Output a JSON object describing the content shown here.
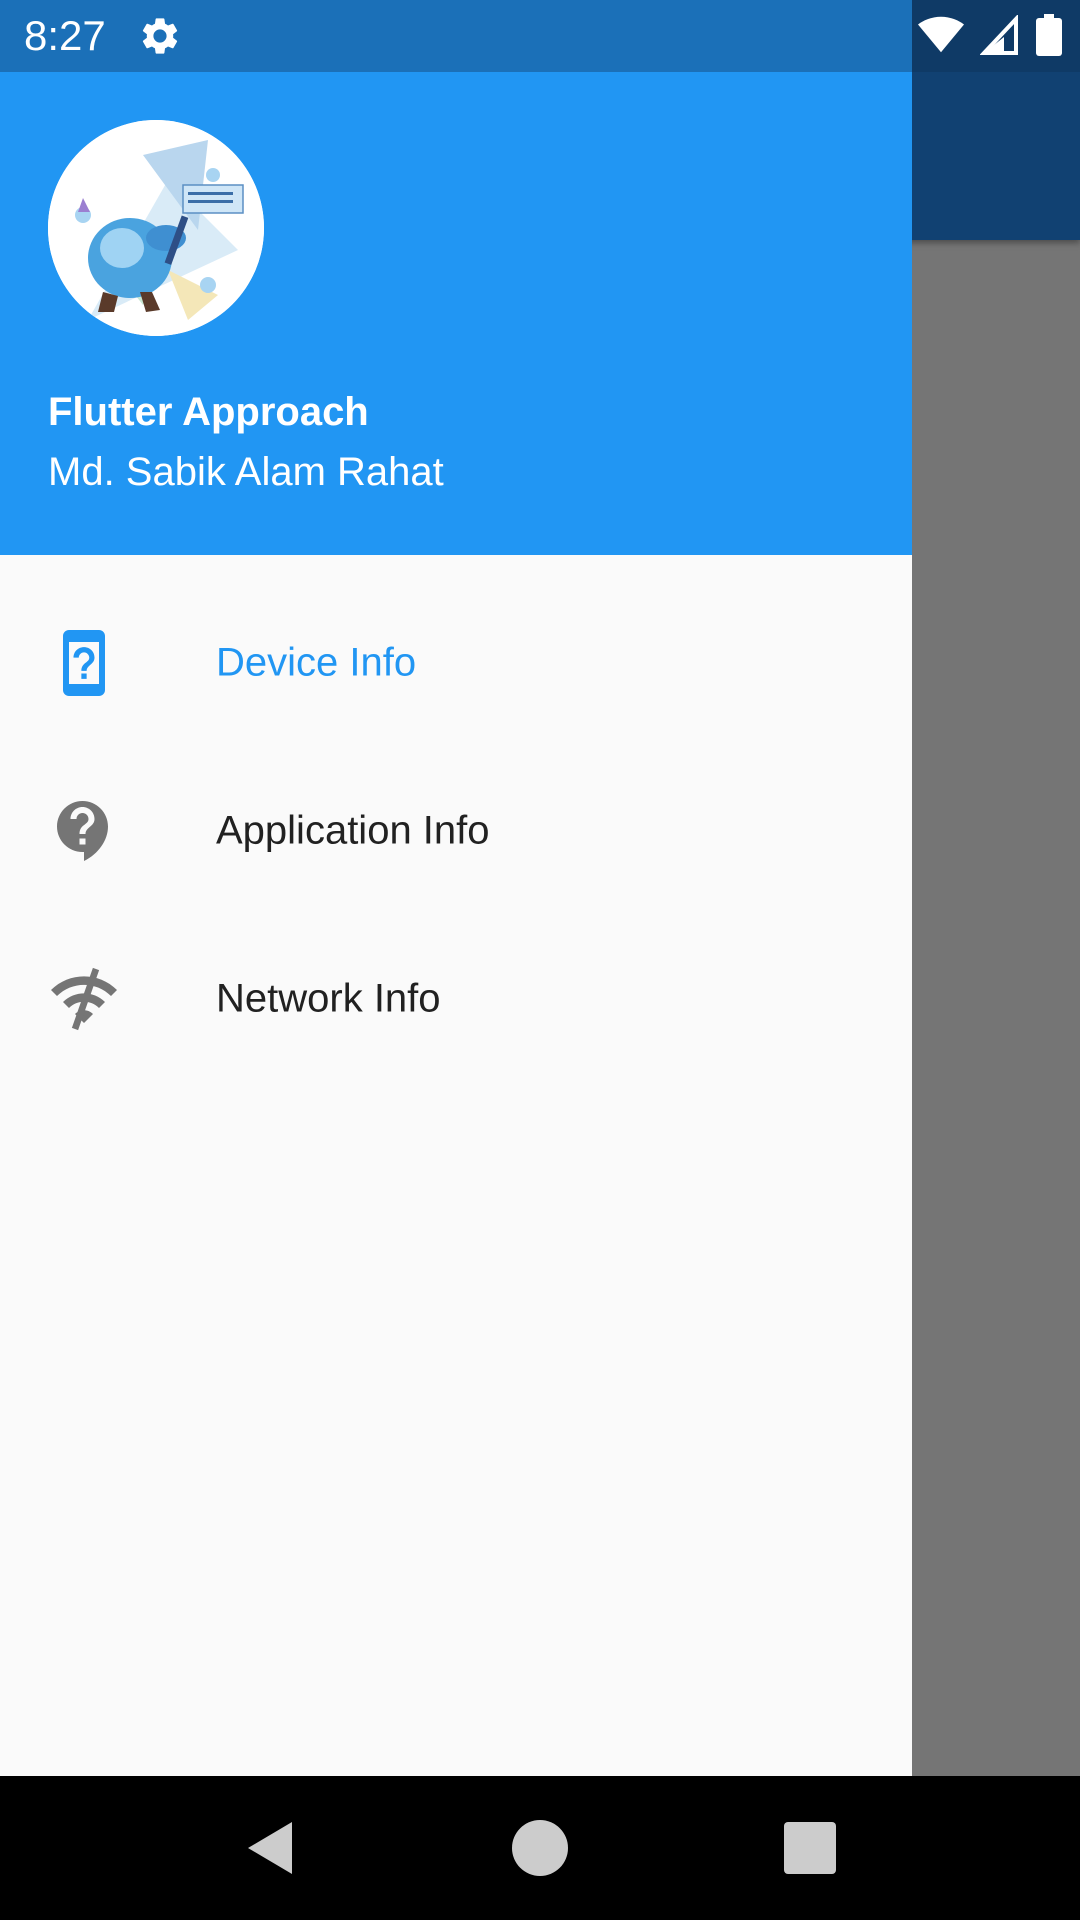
{
  "status_bar": {
    "time": "8:27",
    "icons": [
      "settings-icon",
      "wifi-icon",
      "cellular-signal-icon",
      "battery-icon"
    ]
  },
  "drawer": {
    "header": {
      "account_name": "Flutter Approach",
      "account_email": "Md. Sabik Alam Rahat",
      "background_color": "#2196f3"
    },
    "items": [
      {
        "label": "Device Info",
        "icon": "device-unknown-icon",
        "selected": true
      },
      {
        "label": "Application Info",
        "icon": "help-outline-icon",
        "selected": false
      },
      {
        "label": "Network Info",
        "icon": "wifi-off-icon",
        "selected": false
      }
    ],
    "accent_color": "#2196f3"
  },
  "system_nav": {
    "buttons": [
      "back-icon",
      "home-icon",
      "recents-icon"
    ]
  }
}
